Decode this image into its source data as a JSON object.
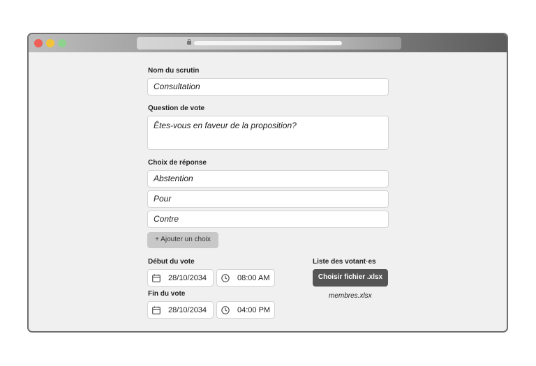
{
  "form": {
    "name_label": "Nom du scrutin",
    "name_value": "Consultation",
    "question_label": "Question de vote",
    "question_value": "Êtes-vous en faveur de la proposition?",
    "choices_label": "Choix de réponse",
    "choices": [
      "Abstention",
      "Pour",
      "Contre"
    ],
    "add_choice_label": "+ Ajouter un choix",
    "start_label": "Début du vote",
    "start_date": "28/10/2034",
    "start_time": "08:00 AM",
    "end_label": "Fin du vote",
    "end_date": "28/10/2034",
    "end_time": "04:00 PM",
    "voters_label": "Liste des votant·es",
    "file_button_label": "Choisir fichier .xlsx",
    "file_name": "membres.xlsx"
  }
}
